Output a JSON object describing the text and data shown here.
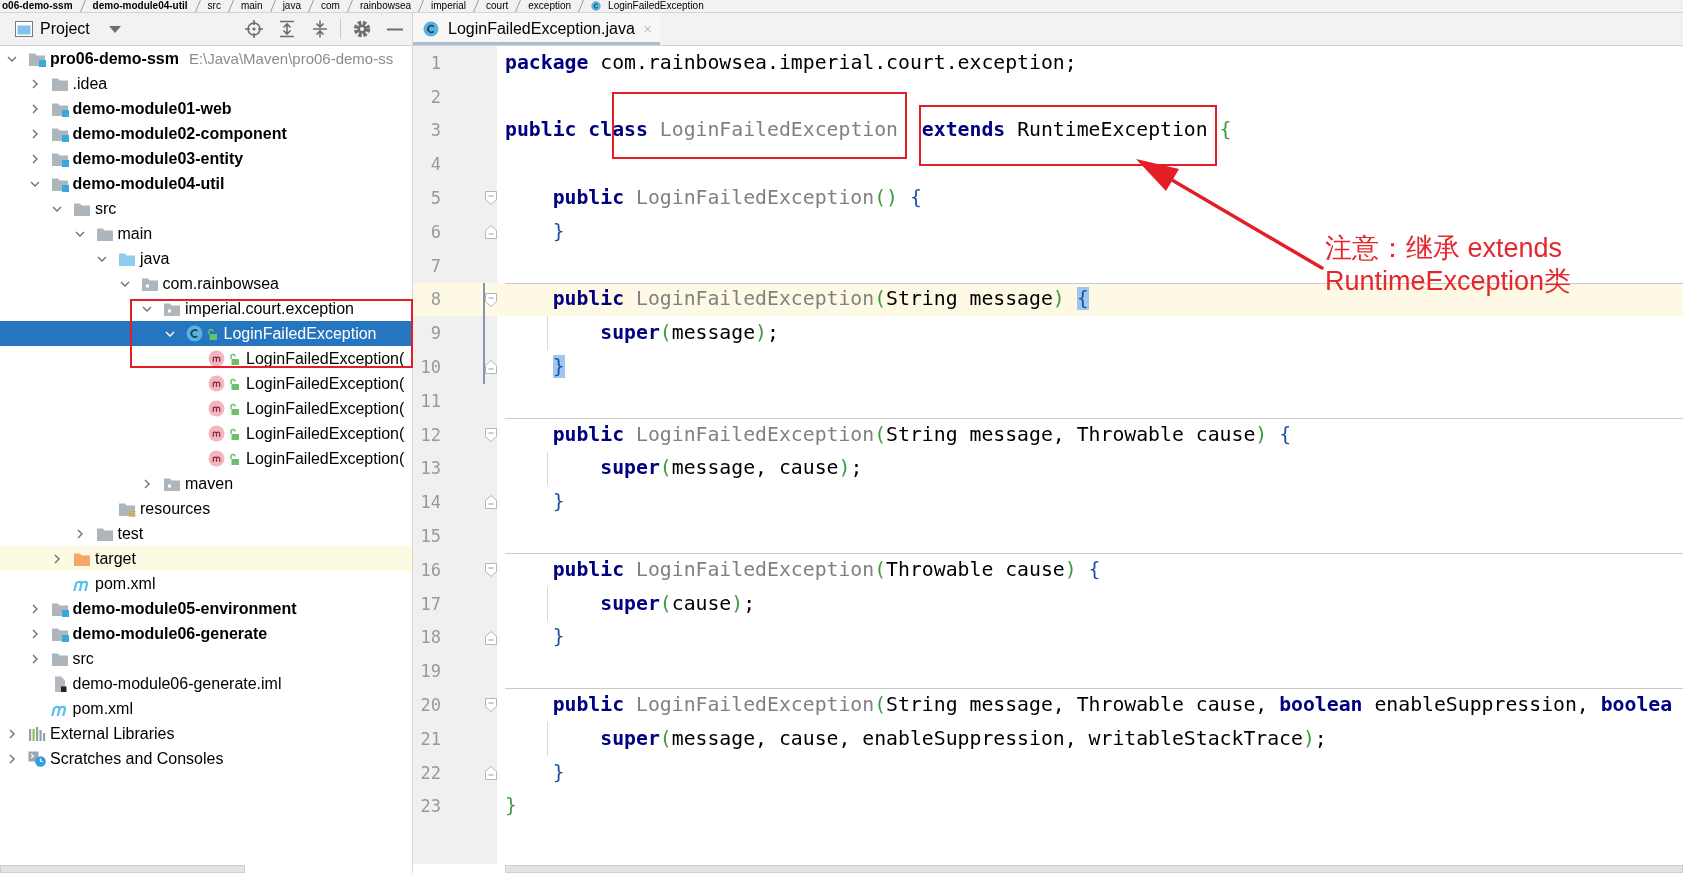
{
  "breadcrumbs": [
    {
      "label": "o06-demo-ssm",
      "kind": "module"
    },
    {
      "label": "demo-module04-util",
      "kind": "module"
    },
    {
      "label": "src",
      "kind": "folder"
    },
    {
      "label": "main",
      "kind": "folder"
    },
    {
      "label": "java",
      "kind": "folder"
    },
    {
      "label": "com",
      "kind": "folder"
    },
    {
      "label": "rainbowsea",
      "kind": "folder"
    },
    {
      "label": "imperial",
      "kind": "folder"
    },
    {
      "label": "court",
      "kind": "folder"
    },
    {
      "label": "exception",
      "kind": "folder"
    },
    {
      "label": "LoginFailedException",
      "kind": "class"
    }
  ],
  "project_panel": {
    "title": "Project"
  },
  "project_tree": [
    {
      "label": "pro06-demo-ssm",
      "path": "E:\\Java\\Maven\\pro06-demo-ss",
      "kind": "module",
      "expanded": true,
      "selected": false,
      "children": [
        {
          "label": ".idea",
          "kind": "folder",
          "expanded": false,
          "selected": false
        },
        {
          "label": "demo-module01-web",
          "kind": "module",
          "expanded": false,
          "selected": false
        },
        {
          "label": "demo-module02-component",
          "kind": "module",
          "expanded": false,
          "selected": false
        },
        {
          "label": "demo-module03-entity",
          "kind": "module",
          "expanded": false,
          "selected": false
        },
        {
          "label": "demo-module04-util",
          "kind": "module",
          "expanded": true,
          "selected": false,
          "children": [
            {
              "label": "src",
              "kind": "folder",
              "expanded": true,
              "selected": false,
              "children": [
                {
                  "label": "main",
                  "kind": "folder",
                  "expanded": true,
                  "selected": false,
                  "children": [
                    {
                      "label": "java",
                      "kind": "source-folder",
                      "expanded": true,
                      "selected": false,
                      "children": [
                        {
                          "label": "com.rainbowsea",
                          "kind": "package",
                          "expanded": true,
                          "selected": false,
                          "children": [
                            {
                              "label": "imperial.court.exception",
                              "kind": "package",
                              "expanded": true,
                              "selected": false,
                              "children": [
                                {
                                  "label": "LoginFailedException",
                                  "kind": "class",
                                  "expanded": true,
                                  "selected": true,
                                  "children": [
                                    {
                                      "label": "LoginFailedException(",
                                      "kind": "method",
                                      "selected": false
                                    },
                                    {
                                      "label": "LoginFailedException(",
                                      "kind": "method",
                                      "selected": false
                                    },
                                    {
                                      "label": "LoginFailedException(",
                                      "kind": "method",
                                      "selected": false
                                    },
                                    {
                                      "label": "LoginFailedException(",
                                      "kind": "method",
                                      "selected": false
                                    },
                                    {
                                      "label": "LoginFailedException(",
                                      "kind": "method",
                                      "selected": false
                                    }
                                  ]
                                }
                              ]
                            },
                            {
                              "label": "maven",
                              "kind": "package",
                              "expanded": false,
                              "selected": false
                            }
                          ]
                        }
                      ]
                    },
                    {
                      "label": "resources",
                      "kind": "resources-folder",
                      "selected": false
                    }
                  ]
                },
                {
                  "label": "test",
                  "kind": "folder",
                  "expanded": false,
                  "selected": false
                }
              ]
            },
            {
              "label": "target",
              "kind": "excluded-folder",
              "expanded": false,
              "selected": false
            },
            {
              "label": "pom.xml",
              "kind": "maven",
              "selected": false
            }
          ]
        },
        {
          "label": "demo-module05-environment",
          "kind": "module",
          "expanded": false,
          "selected": false
        },
        {
          "label": "demo-module06-generate",
          "kind": "module",
          "expanded": false,
          "selected": false
        },
        {
          "label": "src",
          "kind": "folder",
          "expanded": false,
          "selected": false
        },
        {
          "label": "demo-module06-generate.iml",
          "kind": "iml",
          "selected": false
        },
        {
          "label": "pom.xml",
          "kind": "maven",
          "selected": false
        }
      ]
    },
    {
      "label": "External Libraries",
      "kind": "libraries",
      "expanded": false,
      "selected": false
    },
    {
      "label": "Scratches and Consoles",
      "kind": "scratches",
      "expanded": false,
      "selected": false
    }
  ],
  "editor": {
    "tab": {
      "label": "LoginFailedException.java",
      "selected": true
    },
    "lines": [
      {
        "number": "1",
        "current": false,
        "separator": false,
        "tokens": [
          {
            "kind": "keyword",
            "text": "package "
          },
          {
            "kind": "plain",
            "text": "com.rainbowsea.imperial.court.exception;"
          }
        ]
      },
      {
        "number": "2",
        "current": false,
        "separator": false
      },
      {
        "number": "3",
        "current": false,
        "separator": false,
        "tokens": [
          {
            "kind": "keyword",
            "text": "public class "
          },
          {
            "kind": "name",
            "text": "LoginFailedException  "
          },
          {
            "kind": "keyword",
            "text": "extends "
          },
          {
            "kind": "plain",
            "text": "RuntimeException "
          },
          {
            "kind": "outer-brace",
            "text": "{"
          }
        ],
        "children": [
          {
            "number": "4",
            "current": false,
            "separator": false
          },
          {
            "number": "5",
            "kind": "fold-start",
            "current": false,
            "separator": false,
            "tokens": [
              {
                "kind": "keyword",
                "text": "public "
              },
              {
                "kind": "name",
                "text": "LoginFailedException"
              },
              {
                "kind": "paren",
                "text": "() "
              },
              {
                "kind": "brace",
                "text": "{"
              }
            ]
          },
          {
            "number": "6",
            "kind": "fold-end",
            "current": false,
            "separator": false,
            "tokens": [
              {
                "kind": "brace",
                "text": "}"
              }
            ]
          },
          {
            "number": "7",
            "current": false,
            "separator": false
          },
          {
            "number": "8",
            "kind": "fold-start",
            "current": true,
            "separator": true,
            "tokens": [
              {
                "kind": "keyword",
                "text": "public "
              },
              {
                "kind": "name",
                "text": "LoginFailedException"
              },
              {
                "kind": "paren",
                "text": "("
              },
              {
                "kind": "plain",
                "text": "String message"
              },
              {
                "kind": "paren",
                "text": ") "
              },
              {
                "kind": "brace-match",
                "text": "{"
              }
            ],
            "children": [
              {
                "number": "9",
                "current": false,
                "separator": false,
                "tokens": [
                  {
                    "kind": "keyword",
                    "text": "super"
                  },
                  {
                    "kind": "paren",
                    "text": "("
                  },
                  {
                    "kind": "plain",
                    "text": "message"
                  },
                  {
                    "kind": "paren",
                    "text": ")"
                  },
                  {
                    "kind": "plain",
                    "text": ";"
                  }
                ]
              }
            ]
          },
          {
            "number": "10",
            "kind": "fold-end",
            "current": false,
            "separator": false,
            "tokens": [
              {
                "kind": "brace-match",
                "text": "}"
              }
            ]
          },
          {
            "number": "11",
            "current": false,
            "separator": false
          },
          {
            "number": "12",
            "kind": "fold-start",
            "current": false,
            "separator": true,
            "tokens": [
              {
                "kind": "keyword",
                "text": "public "
              },
              {
                "kind": "name",
                "text": "LoginFailedException"
              },
              {
                "kind": "paren",
                "text": "("
              },
              {
                "kind": "plain",
                "text": "String message, Throwable cause"
              },
              {
                "kind": "paren",
                "text": ") "
              },
              {
                "kind": "brace",
                "text": "{"
              }
            ],
            "children": [
              {
                "number": "13",
                "current": false,
                "separator": false,
                "tokens": [
                  {
                    "kind": "keyword",
                    "text": "super"
                  },
                  {
                    "kind": "paren",
                    "text": "("
                  },
                  {
                    "kind": "plain",
                    "text": "message, cause"
                  },
                  {
                    "kind": "paren",
                    "text": ")"
                  },
                  {
                    "kind": "plain",
                    "text": ";"
                  }
                ]
              }
            ]
          },
          {
            "number": "14",
            "kind": "fold-end",
            "current": false,
            "separator": false,
            "tokens": [
              {
                "kind": "brace",
                "text": "}"
              }
            ]
          },
          {
            "number": "15",
            "current": false,
            "separator": false
          },
          {
            "number": "16",
            "kind": "fold-start",
            "current": false,
            "separator": true,
            "tokens": [
              {
                "kind": "keyword",
                "text": "public "
              },
              {
                "kind": "name",
                "text": "LoginFailedException"
              },
              {
                "kind": "paren",
                "text": "("
              },
              {
                "kind": "plain",
                "text": "Throwable cause"
              },
              {
                "kind": "paren",
                "text": ") "
              },
              {
                "kind": "brace",
                "text": "{"
              }
            ],
            "children": [
              {
                "number": "17",
                "current": false,
                "separator": false,
                "tokens": [
                  {
                    "kind": "keyword",
                    "text": "super"
                  },
                  {
                    "kind": "paren",
                    "text": "("
                  },
                  {
                    "kind": "plain",
                    "text": "cause"
                  },
                  {
                    "kind": "paren",
                    "text": ")"
                  },
                  {
                    "kind": "plain",
                    "text": ";"
                  }
                ]
              }
            ]
          },
          {
            "number": "18",
            "kind": "fold-end",
            "current": false,
            "separator": false,
            "tokens": [
              {
                "kind": "brace",
                "text": "}"
              }
            ]
          },
          {
            "number": "19",
            "current": false,
            "separator": false
          },
          {
            "number": "20",
            "kind": "fold-start",
            "current": false,
            "separator": true,
            "tokens": [
              {
                "kind": "keyword",
                "text": "public "
              },
              {
                "kind": "name",
                "text": "LoginFailedException"
              },
              {
                "kind": "paren",
                "text": "("
              },
              {
                "kind": "plain",
                "text": "String message, Throwable cause, "
              },
              {
                "kind": "keyword",
                "text": "boolean "
              },
              {
                "kind": "plain",
                "text": "enableSuppression, "
              },
              {
                "kind": "keyword",
                "text": "boolea"
              }
            ],
            "children": [
              {
                "number": "21",
                "current": false,
                "separator": false,
                "tokens": [
                  {
                    "kind": "keyword",
                    "text": "super"
                  },
                  {
                    "kind": "paren",
                    "text": "("
                  },
                  {
                    "kind": "plain",
                    "text": "message, cause, enableSuppression, writableStackTrace"
                  },
                  {
                    "kind": "paren",
                    "text": ")"
                  },
                  {
                    "kind": "plain",
                    "text": ";"
                  }
                ]
              }
            ]
          },
          {
            "number": "22",
            "kind": "fold-end",
            "current": false,
            "separator": false,
            "tokens": [
              {
                "kind": "brace",
                "text": "}"
              }
            ]
          }
        ]
      },
      {
        "number": "23",
        "current": false,
        "separator": false,
        "tokens": [
          {
            "kind": "outer-brace",
            "text": "}"
          }
        ]
      }
    ]
  },
  "annotations": [
    {
      "kind": "box"
    },
    {
      "kind": "box"
    },
    {
      "kind": "box"
    },
    {
      "kind": "arrow"
    },
    {
      "kind": "note",
      "text": "注意：继承 extends\nRuntimeException类"
    }
  ]
}
